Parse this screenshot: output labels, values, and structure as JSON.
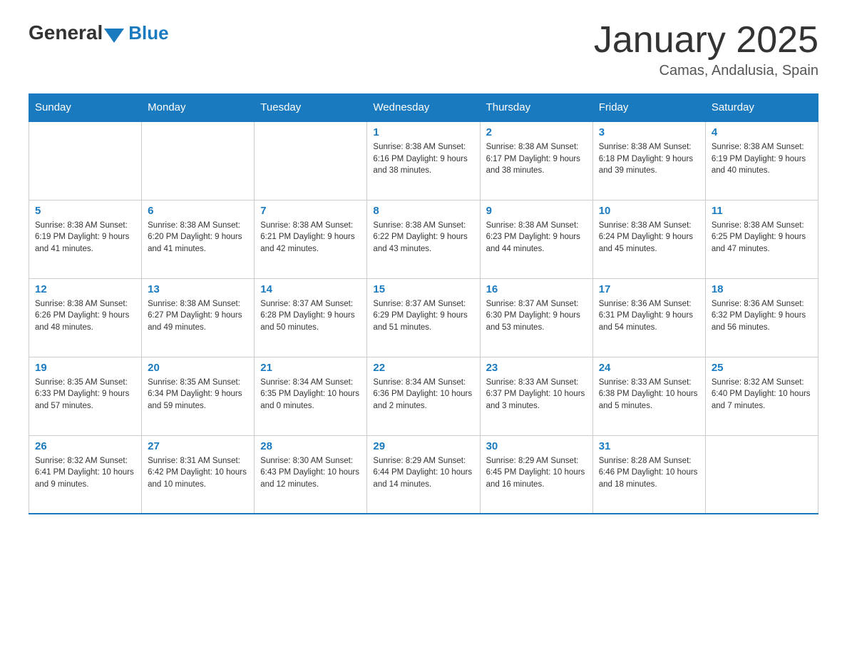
{
  "logo": {
    "general": "General",
    "blue": "Blue"
  },
  "title": "January 2025",
  "location": "Camas, Andalusia, Spain",
  "days_of_week": [
    "Sunday",
    "Monday",
    "Tuesday",
    "Wednesday",
    "Thursday",
    "Friday",
    "Saturday"
  ],
  "weeks": [
    [
      {
        "day": "",
        "info": ""
      },
      {
        "day": "",
        "info": ""
      },
      {
        "day": "",
        "info": ""
      },
      {
        "day": "1",
        "info": "Sunrise: 8:38 AM\nSunset: 6:16 PM\nDaylight: 9 hours\nand 38 minutes."
      },
      {
        "day": "2",
        "info": "Sunrise: 8:38 AM\nSunset: 6:17 PM\nDaylight: 9 hours\nand 38 minutes."
      },
      {
        "day": "3",
        "info": "Sunrise: 8:38 AM\nSunset: 6:18 PM\nDaylight: 9 hours\nand 39 minutes."
      },
      {
        "day": "4",
        "info": "Sunrise: 8:38 AM\nSunset: 6:19 PM\nDaylight: 9 hours\nand 40 minutes."
      }
    ],
    [
      {
        "day": "5",
        "info": "Sunrise: 8:38 AM\nSunset: 6:19 PM\nDaylight: 9 hours\nand 41 minutes."
      },
      {
        "day": "6",
        "info": "Sunrise: 8:38 AM\nSunset: 6:20 PM\nDaylight: 9 hours\nand 41 minutes."
      },
      {
        "day": "7",
        "info": "Sunrise: 8:38 AM\nSunset: 6:21 PM\nDaylight: 9 hours\nand 42 minutes."
      },
      {
        "day": "8",
        "info": "Sunrise: 8:38 AM\nSunset: 6:22 PM\nDaylight: 9 hours\nand 43 minutes."
      },
      {
        "day": "9",
        "info": "Sunrise: 8:38 AM\nSunset: 6:23 PM\nDaylight: 9 hours\nand 44 minutes."
      },
      {
        "day": "10",
        "info": "Sunrise: 8:38 AM\nSunset: 6:24 PM\nDaylight: 9 hours\nand 45 minutes."
      },
      {
        "day": "11",
        "info": "Sunrise: 8:38 AM\nSunset: 6:25 PM\nDaylight: 9 hours\nand 47 minutes."
      }
    ],
    [
      {
        "day": "12",
        "info": "Sunrise: 8:38 AM\nSunset: 6:26 PM\nDaylight: 9 hours\nand 48 minutes."
      },
      {
        "day": "13",
        "info": "Sunrise: 8:38 AM\nSunset: 6:27 PM\nDaylight: 9 hours\nand 49 minutes."
      },
      {
        "day": "14",
        "info": "Sunrise: 8:37 AM\nSunset: 6:28 PM\nDaylight: 9 hours\nand 50 minutes."
      },
      {
        "day": "15",
        "info": "Sunrise: 8:37 AM\nSunset: 6:29 PM\nDaylight: 9 hours\nand 51 minutes."
      },
      {
        "day": "16",
        "info": "Sunrise: 8:37 AM\nSunset: 6:30 PM\nDaylight: 9 hours\nand 53 minutes."
      },
      {
        "day": "17",
        "info": "Sunrise: 8:36 AM\nSunset: 6:31 PM\nDaylight: 9 hours\nand 54 minutes."
      },
      {
        "day": "18",
        "info": "Sunrise: 8:36 AM\nSunset: 6:32 PM\nDaylight: 9 hours\nand 56 minutes."
      }
    ],
    [
      {
        "day": "19",
        "info": "Sunrise: 8:35 AM\nSunset: 6:33 PM\nDaylight: 9 hours\nand 57 minutes."
      },
      {
        "day": "20",
        "info": "Sunrise: 8:35 AM\nSunset: 6:34 PM\nDaylight: 9 hours\nand 59 minutes."
      },
      {
        "day": "21",
        "info": "Sunrise: 8:34 AM\nSunset: 6:35 PM\nDaylight: 10 hours\nand 0 minutes."
      },
      {
        "day": "22",
        "info": "Sunrise: 8:34 AM\nSunset: 6:36 PM\nDaylight: 10 hours\nand 2 minutes."
      },
      {
        "day": "23",
        "info": "Sunrise: 8:33 AM\nSunset: 6:37 PM\nDaylight: 10 hours\nand 3 minutes."
      },
      {
        "day": "24",
        "info": "Sunrise: 8:33 AM\nSunset: 6:38 PM\nDaylight: 10 hours\nand 5 minutes."
      },
      {
        "day": "25",
        "info": "Sunrise: 8:32 AM\nSunset: 6:40 PM\nDaylight: 10 hours\nand 7 minutes."
      }
    ],
    [
      {
        "day": "26",
        "info": "Sunrise: 8:32 AM\nSunset: 6:41 PM\nDaylight: 10 hours\nand 9 minutes."
      },
      {
        "day": "27",
        "info": "Sunrise: 8:31 AM\nSunset: 6:42 PM\nDaylight: 10 hours\nand 10 minutes."
      },
      {
        "day": "28",
        "info": "Sunrise: 8:30 AM\nSunset: 6:43 PM\nDaylight: 10 hours\nand 12 minutes."
      },
      {
        "day": "29",
        "info": "Sunrise: 8:29 AM\nSunset: 6:44 PM\nDaylight: 10 hours\nand 14 minutes."
      },
      {
        "day": "30",
        "info": "Sunrise: 8:29 AM\nSunset: 6:45 PM\nDaylight: 10 hours\nand 16 minutes."
      },
      {
        "day": "31",
        "info": "Sunrise: 8:28 AM\nSunset: 6:46 PM\nDaylight: 10 hours\nand 18 minutes."
      },
      {
        "day": "",
        "info": ""
      }
    ]
  ]
}
